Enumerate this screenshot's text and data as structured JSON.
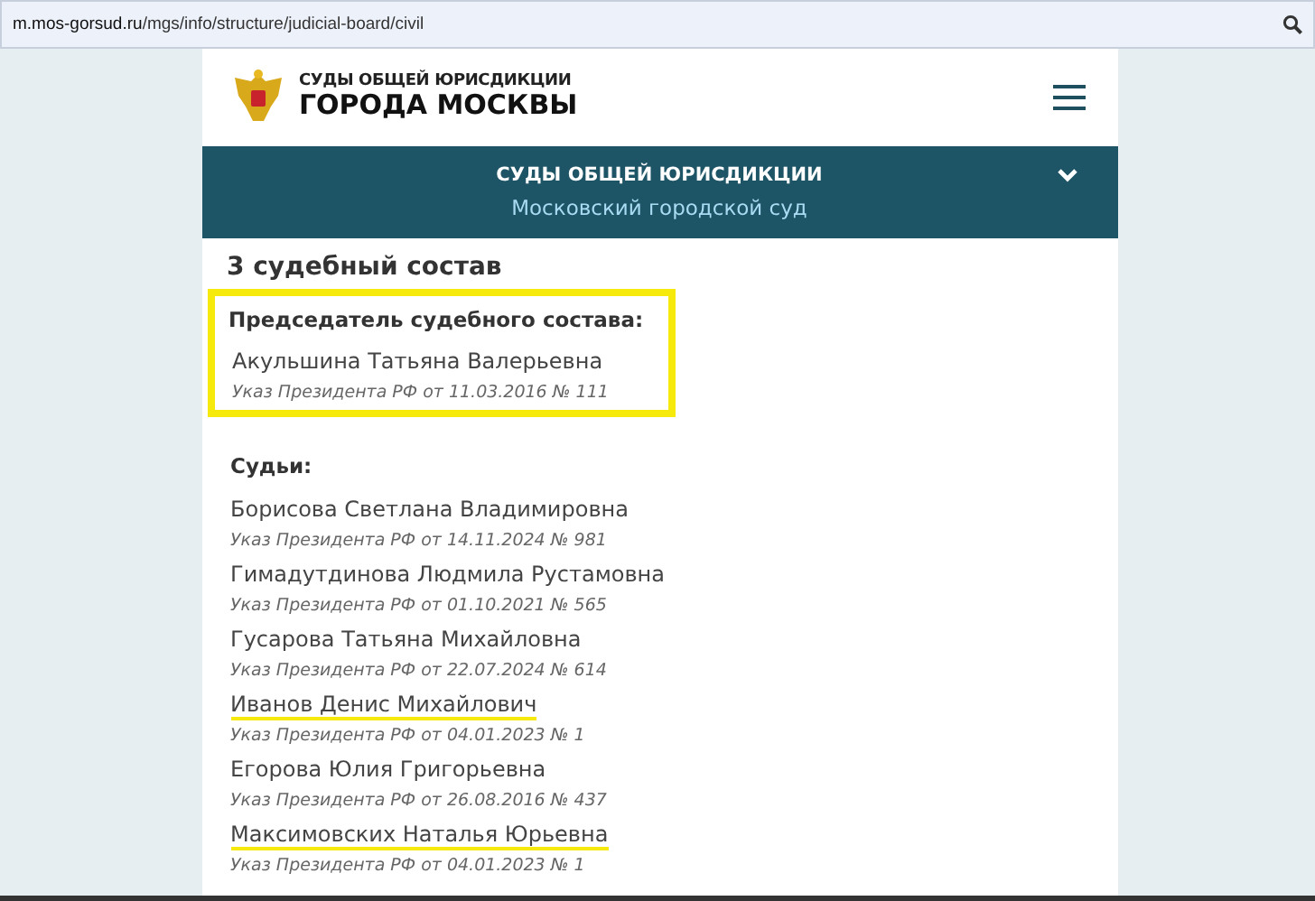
{
  "address_bar": {
    "domain": "m.mos-gorsud.ru",
    "path": "/mgs/info/structure/judicial-board/civil"
  },
  "header": {
    "logo_top": "СУДЫ ОБЩЕЙ ЮРИСДИКЦИИ",
    "logo_bottom": "ГОРОДА МОСКВЫ"
  },
  "nav": {
    "title": "СУДЫ ОБЩЕЙ ЮРИСДИКЦИИ",
    "subtitle": "Московский городской суд",
    "expanded": false
  },
  "section_title": "3 судебный состав",
  "chairman": {
    "heading": "Председатель судебного состава:",
    "name": "Акульшина Татьяна Валерьевна",
    "decree": "Указ Президента РФ от 11.03.2016 № 111",
    "highlighted": true
  },
  "judges_heading": "Судьи:",
  "judges": [
    {
      "name": "Борисова Светлана Владимировна",
      "decree": "Указ Президента РФ от 14.11.2024 № 981",
      "underlined": false
    },
    {
      "name": "Гимадутдинова Людмила Рустамовна",
      "decree": "Указ Президента РФ от 01.10.2021 № 565",
      "underlined": false
    },
    {
      "name": "Гусарова Татьяна Михайловна",
      "decree": "Указ Президента РФ от 22.07.2024 № 614",
      "underlined": false
    },
    {
      "name": "Иванов Денис Михайлович",
      "decree": "Указ Президента РФ от 04.01.2023 № 1",
      "underlined": true
    },
    {
      "name": "Егорова Юлия Григорьевна",
      "decree": "Указ Президента РФ от 26.08.2016 № 437",
      "underlined": false
    },
    {
      "name": "Максимовских Наталья Юрьевна",
      "decree": "Указ Президента РФ от 04.01.2023 № 1",
      "underlined": true
    }
  ]
}
